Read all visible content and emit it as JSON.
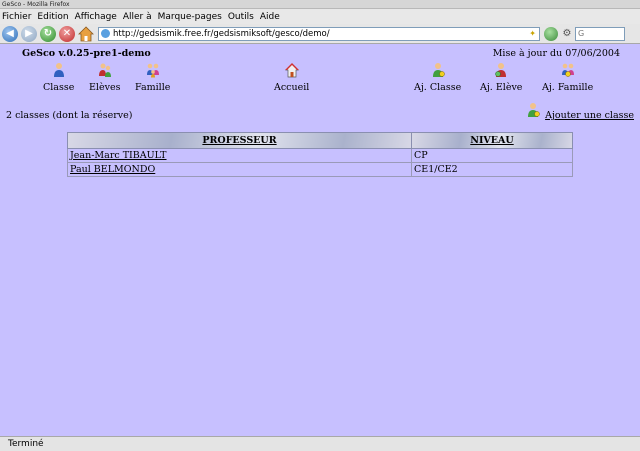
{
  "window": {
    "title": "GeSco - Mozilla Firefox"
  },
  "menu": [
    {
      "label": "Fichier"
    },
    {
      "label": "Edition"
    },
    {
      "label": "Affichage"
    },
    {
      "label": "Aller à"
    },
    {
      "label": "Marque-pages"
    },
    {
      "label": "Outils"
    },
    {
      "label": "Aide"
    }
  ],
  "navigation": {
    "url": "http://gedsismik.free.fr/gedsismiksoft/gesco/demo/",
    "search_placeholder": "G"
  },
  "page": {
    "app_title": "GeSco v.0.25-pre1-demo",
    "updated": "Mise à jour du 07/06/2004",
    "nav": {
      "classe": "Classe",
      "eleves": "Elèves",
      "famille": "Famille",
      "accueil": "Accueil",
      "aj_classe": "Aj. Classe",
      "aj_eleve": "Aj. Elève",
      "aj_famille": "Aj. Famille"
    },
    "count_text": "2 classes (dont la réserve)",
    "add_class": "Ajouter une classe",
    "table": {
      "headers": [
        "PROFESSEUR",
        "NIVEAU"
      ],
      "rows": [
        {
          "professeur": "Jean-Marc TIBAULT",
          "niveau": "CP"
        },
        {
          "professeur": "Paul BELMONDO",
          "niveau": "CE1/CE2"
        }
      ]
    }
  },
  "status": {
    "text": "Terminé"
  },
  "colors": {
    "page_background": "#c7c0ff",
    "chrome": "#e6e6e6"
  }
}
